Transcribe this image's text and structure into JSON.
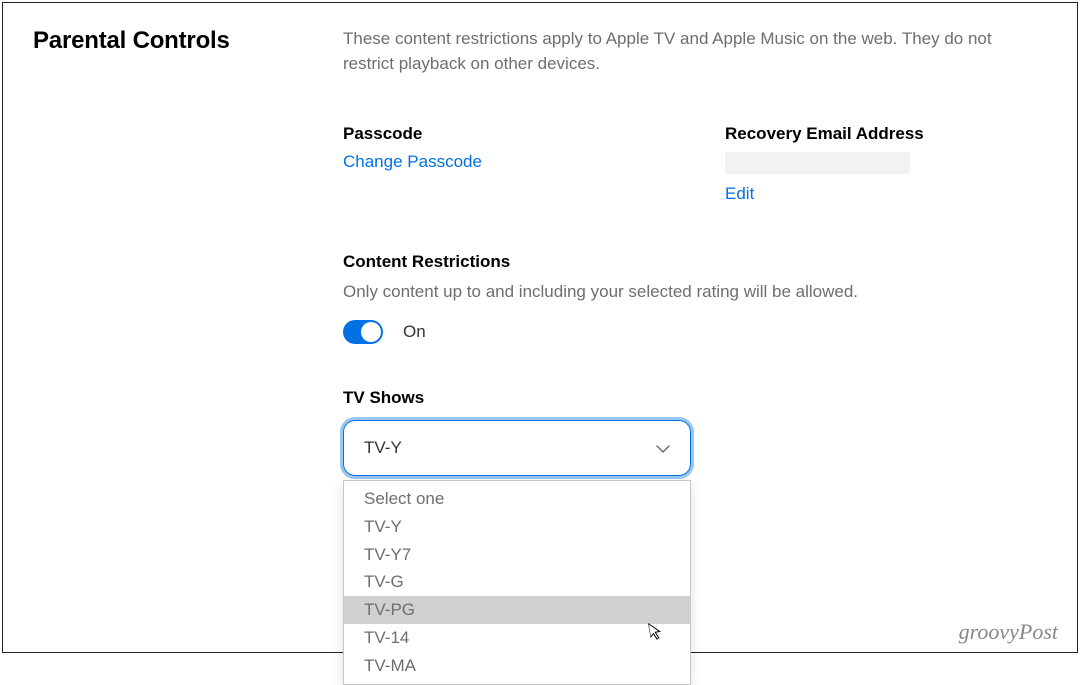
{
  "page": {
    "title": "Parental Controls",
    "description": "These content restrictions apply to Apple TV and Apple Music on the web. They do not restrict playback on other devices."
  },
  "passcode": {
    "label": "Passcode",
    "change_link": "Change Passcode"
  },
  "recovery": {
    "label": "Recovery Email Address",
    "edit_link": "Edit"
  },
  "restrictions": {
    "label": "Content Restrictions",
    "helper": "Only content up to and including your selected rating will be allowed.",
    "toggle_state": "On"
  },
  "tvshows": {
    "label": "TV Shows",
    "selected": "TV-Y",
    "options": [
      {
        "label": "Select one",
        "highlighted": false
      },
      {
        "label": "TV-Y",
        "highlighted": false
      },
      {
        "label": "TV-Y7",
        "highlighted": false
      },
      {
        "label": "TV-G",
        "highlighted": false
      },
      {
        "label": "TV-PG",
        "highlighted": true
      },
      {
        "label": "TV-14",
        "highlighted": false
      },
      {
        "label": "TV-MA",
        "highlighted": false
      }
    ]
  },
  "watermark": "groovyPost"
}
